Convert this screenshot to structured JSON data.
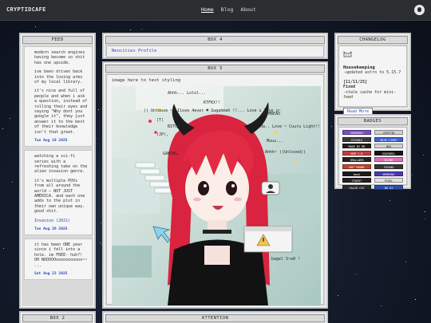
{
  "brand": "CRYPTIDCAFE",
  "nav": [
    {
      "label": "Home",
      "active": true
    },
    {
      "label": "Blog",
      "active": false
    },
    {
      "label": "About",
      "active": false
    }
  ],
  "feed": {
    "title": "FEED",
    "posts": [
      {
        "paragraphs": [
          "modern search engines having become so shit has one upside.",
          "ive been driven back into the loving arms of my local library.",
          "it's nice and full of people and when i ask a question, instead of rolling their eyes and saying \"Why dont you google it\", they just answer it to the best of their knowledge isn't that great."
        ],
        "date": "Tue Aug 19 2025"
      },
      {
        "paragraphs": [
          "watching a sci-fi series with a refreshing take on the alien invasion genre.",
          "it's multiple POVs from all around the world — NOT JUST AMERICA. and each one adds to the plot in their own unique way. good shit."
        ],
        "link": "Invasion (2021)",
        "date": "Tue Aug 26 2025"
      },
      {
        "paragraphs": [
          "it has been ONE year since i fell into a hole. im FREE- huh?! OH NOOOOOooooooooooo~~ ..."
        ],
        "date": "Sat Aug 23 2025"
      }
    ]
  },
  "box2": {
    "title": "BOX 2"
  },
  "box4": {
    "title": "BOX 4",
    "content": "Neocities Profile"
  },
  "box5": {
    "title": "BOX 5",
    "caption": "image here to test styling"
  },
  "attention": {
    "title": "ATTENTION"
  },
  "changelog": {
    "title": "CHANGELOG",
    "section": "Housekeeping",
    "line1": "-updated astro to 5.15.7",
    "date": "[11/11/25]",
    "fixed_label": "Fixed",
    "line2": "-stale cache for mini-feed",
    "button": "Read More"
  },
  "badges": {
    "title": "BADGES",
    "items": [
      {
        "label": "SOMEBODY",
        "color": "#7a4fc2"
      },
      {
        "label": "CRYPTID",
        "color": "#d0d0d0"
      },
      {
        "label": "VISIBLE",
        "color": "#3a3a3a"
      },
      {
        "label": "BLUE LIGHT",
        "color": "#3f63d6"
      },
      {
        "label": "MADE BY ME",
        "color": "#1f1f1f"
      },
      {
        "label": "NEO",
        "color": "#d0d0d0"
      },
      {
        "label": "WEB 1.0",
        "color": "#c43c3c"
      },
      {
        "label": "SQUIRREL",
        "color": "#151515"
      },
      {
        "label": "SMALLWEB",
        "color": "#232323"
      },
      {
        "label": "BLINK",
        "color": "#e36fb6"
      },
      {
        "label": "NOT FOUND",
        "color": "#c2442a"
      },
      {
        "label": "FRIEND",
        "color": "#353535"
      },
      {
        "label": "bash",
        "color": "#1b1b1b"
      },
      {
        "label": "WEBRING",
        "color": "#4b39b0"
      },
      {
        "label": "TEAPOT",
        "color": "#222222"
      },
      {
        "label": "PIXEL",
        "color": "#e0e0e0"
      },
      {
        "label": "VALID CSS",
        "color": "#2b2b2b"
      },
      {
        "label": "NO AI",
        "color": "#2f4fb0"
      }
    ]
  },
  "art": {
    "speech_lines": [
      "Ahhh... Lolol...",
      "KTFKX!!",
      "(( Untouse ~♥ Ilove 4ever ♥ Sugahmah !!... Love u love u~",
      "(T)",
      "BITCH!!",
      "(JP),",
      "BOMBEAD",
      "Ha.. Love ~ Cuuru Light!!",
      "Muuu...",
      "Ahhh~ ((Unloved))",
      "GAMING.",
      "bagel S~w0 !"
    ]
  },
  "colors": {
    "accent": "#2a4cc0",
    "window": "#d9d9d9",
    "topbar": "#2b2d31"
  }
}
